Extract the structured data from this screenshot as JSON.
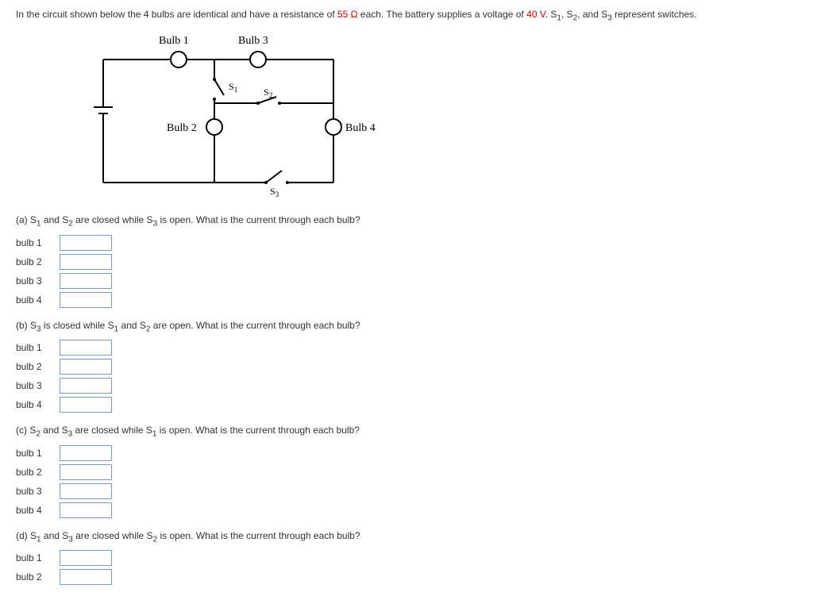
{
  "intro": {
    "part1": "In the circuit shown below the 4 bulbs are identical and have a resistance of ",
    "resistance": "55 Ω",
    "part2": " each. The battery supplies a voltage of ",
    "voltage": "40 V",
    "part3": ". S",
    "s1_sub": "1",
    "part4": ", S",
    "s2_sub": "2",
    "part5": ", and S",
    "s3_sub": "3",
    "part6": " represent switches."
  },
  "diagram": {
    "bulb1": "Bulb 1",
    "bulb2": "Bulb 2",
    "bulb3": "Bulb 3",
    "bulb4": "Bulb 4",
    "s1": "S",
    "s1_sub": "1",
    "s2": "S",
    "s2_sub": "2",
    "s3": "S",
    "s3_sub": "3"
  },
  "questions": {
    "a": {
      "prefix": "(a) S",
      "s1": "1",
      "mid1": " and S",
      "s2": "2",
      "mid2": " are closed while S",
      "s3": "3",
      "suffix": " is open. What is the current through each bulb?"
    },
    "b": {
      "prefix": "(b) S",
      "s1": "3",
      "mid1": " is closed while S",
      "s2": "1",
      "mid2": " and S",
      "s3": "2",
      "suffix": " are open. What is the current through each bulb?"
    },
    "c": {
      "prefix": "(c) S",
      "s1": "2",
      "mid1": " and S",
      "s2": "3",
      "mid2": " are closed while S",
      "s3": "1",
      "suffix": " is open. What is the current through each bulb?"
    },
    "d": {
      "prefix": "(d) S",
      "s1": "1",
      "mid1": " and S",
      "s2": "3",
      "mid2": " are closed while S",
      "s3": "2",
      "suffix": " is open. What is the current through each bulb?"
    }
  },
  "labels": {
    "bulb1": "bulb 1",
    "bulb2": "bulb 2",
    "bulb3": "bulb 3",
    "bulb4": "bulb 4"
  }
}
